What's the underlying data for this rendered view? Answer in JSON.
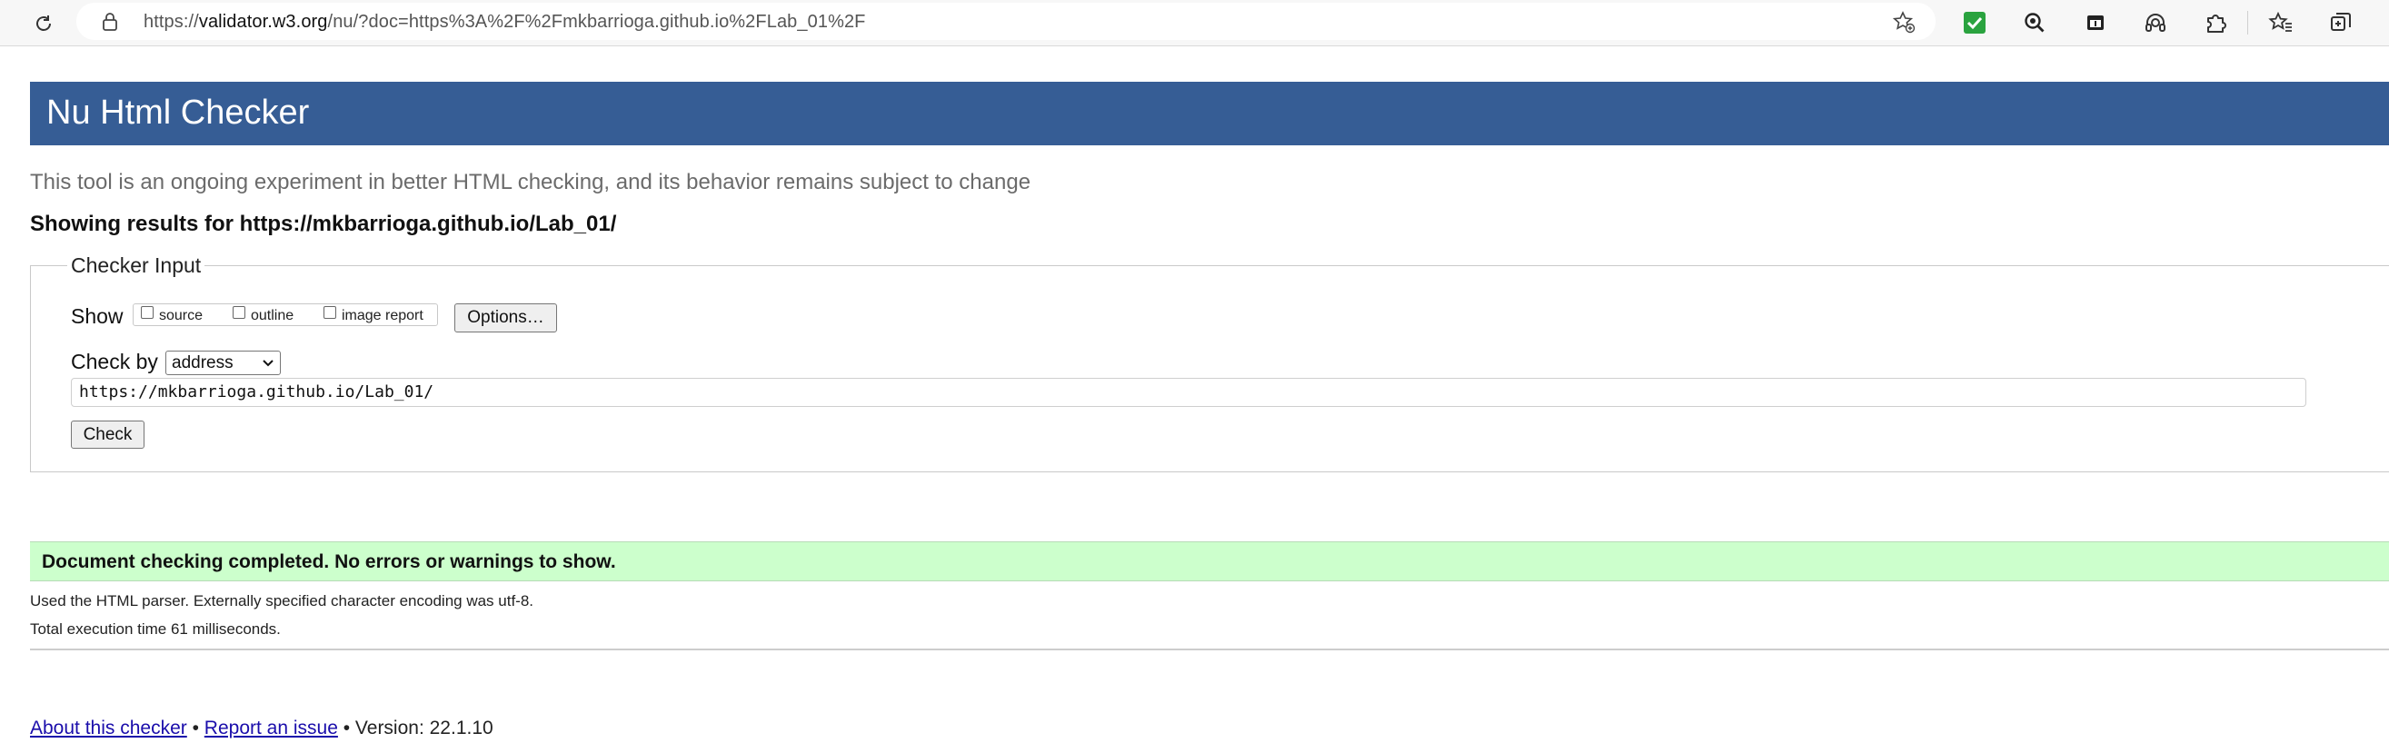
{
  "browser": {
    "url_prefix": "https://",
    "url_host": "validator.w3.org",
    "url_path": "/nu/?doc=https%3A%2F%2Fmkbarrioga.github.io%2FLab_01%2F",
    "toolbar_icons": [
      "extension-checkmark-icon",
      "search-lens-icon",
      "calendar-icon",
      "headphones-icon",
      "puzzle-icon",
      "favorites-icon",
      "collections-icon"
    ],
    "accent": "#2aa33f"
  },
  "page": {
    "title": "Nu Html Checker",
    "header_color": "#365d95",
    "subtitle": "This tool is an ongoing experiment in better HTML checking, and its behavior remains subject to change",
    "results_for": "Showing results for https://mkbarrioga.github.io/Lab_01/"
  },
  "checker_input": {
    "legend": "Checker Input",
    "show_label": "Show",
    "show_options": [
      "source",
      "outline",
      "image report"
    ],
    "options_button": "Options…",
    "checkby_label": "Check by",
    "checkby_value": "address",
    "url_value": "https://mkbarrioga.github.io/Lab_01/",
    "check_button": "Check"
  },
  "result": {
    "message": "Document checking completed. No errors or warnings to show.",
    "success_color": "#ccffcc",
    "parser_info": "Used the HTML parser. Externally specified character encoding was utf-8.",
    "execution_time": "Total execution time 61 milliseconds."
  },
  "footer": {
    "about_link": "About this checker",
    "sep1": " • ",
    "report_link": "Report an issue",
    "version": " • Version: 22.1.10"
  }
}
